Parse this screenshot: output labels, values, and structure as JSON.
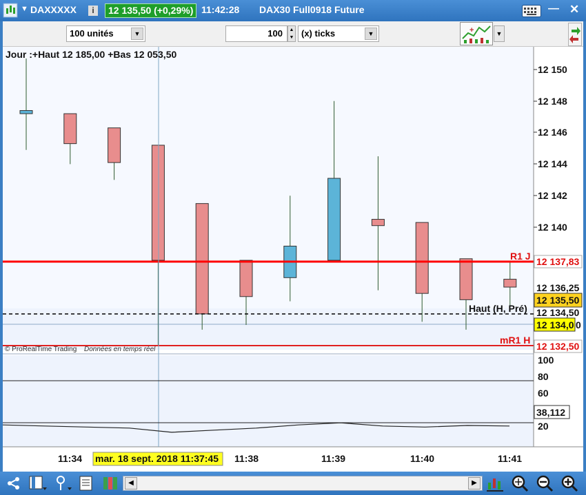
{
  "window": {
    "symbol": "DAXXXXX",
    "price_badge": "12 135,50 (+0,29%)",
    "time": "11:42:28",
    "instrument": "DAX30 Full0918 Future",
    "info_icon": "info-icon",
    "keyboard_icon": "keyboard-icon",
    "colors": {
      "titlebar": "#2f74be",
      "badge": "#1e9e2a"
    }
  },
  "toolbar": {
    "units_value": "100 unités",
    "ticks_value": "100",
    "ticks_unit": "(x) ticks"
  },
  "chart": {
    "header": "Jour :+Haut 12 185,00 +Bas 12 053,50",
    "watermark": "© ProRealTime Trading",
    "watermark_note": "Données en temps réel",
    "line_labels": {
      "r1": "R1 J",
      "mr1": "mR1 H",
      "haut": "Haut (H, Pré)"
    },
    "colors": {
      "bull": "#5cb4d8",
      "bear": "#e88d8d",
      "pivot": "#ff0000",
      "current": "#ffd21f"
    },
    "price_badges": {
      "r1": "12 137,83",
      "p136": "12 136,25",
      "current": "12 135,50",
      "hidden": "12 134,50",
      "p134": "12 134,0",
      "p134_suffix": "0",
      "mr1": "12 132,50"
    },
    "y_ticks": [
      "12 150",
      "12 148",
      "12 146",
      "12 144",
      "12 142",
      "12 140"
    ],
    "osc_ticks": [
      "100",
      "80",
      "60",
      "20"
    ],
    "osc_value": "38,112",
    "x_ticks": [
      "11:34",
      "11:38",
      "11:39",
      "11:40",
      "11:41"
    ],
    "cursor_date": "mar. 18 sept. 2018 11:37:45"
  },
  "chart_data": {
    "type": "candlestick",
    "title": "Jour :+Haut 12 185,00 +Bas 12 053,50",
    "ylim": [
      12132.5,
      12150.5
    ],
    "levels": {
      "R1 J": 12137.83,
      "mR1 H": 12132.5,
      "Haut (H, Pré)": 12134.5,
      "current": 12135.5
    },
    "candles": [
      {
        "o": 12147.2,
        "h": 12150.7,
        "l": 12144.9,
        "c": 12147.4
      },
      {
        "o": 12147.2,
        "h": 12147.2,
        "l": 12144.0,
        "c": 12145.3
      },
      {
        "o": 12146.3,
        "h": 12146.3,
        "l": 12143.0,
        "c": 12144.1
      },
      {
        "o": 12145.2,
        "h": 12145.2,
        "l": 12132.5,
        "c": 12137.9
      },
      {
        "o": 12141.5,
        "h": 12141.5,
        "l": 12133.5,
        "c": 12134.5
      },
      {
        "o": 12137.9,
        "h": 12137.9,
        "l": 12133.8,
        "c": 12135.6
      },
      {
        "o": 12136.8,
        "h": 12142.0,
        "l": 12135.3,
        "c": 12138.8
      },
      {
        "o": 12137.9,
        "h": 12148.0,
        "l": 12137.9,
        "c": 12143.1
      },
      {
        "o": 12140.5,
        "h": 12144.5,
        "l": 12136.0,
        "c": 12140.1
      },
      {
        "o": 12140.3,
        "h": 12140.3,
        "l": 12134.0,
        "c": 12135.8
      },
      {
        "o": 12138.0,
        "h": 12138.0,
        "l": 12133.5,
        "c": 12135.4
      },
      {
        "o": 12136.7,
        "h": 12137.8,
        "l": 12135.0,
        "c": 12136.2
      }
    ],
    "oscillator": {
      "ylim": [
        0,
        100
      ],
      "levels": [
        70,
        30
      ],
      "values": [
        38,
        37,
        36,
        35,
        31,
        33,
        35,
        38,
        40,
        37,
        36,
        37.5,
        37
      ]
    }
  }
}
